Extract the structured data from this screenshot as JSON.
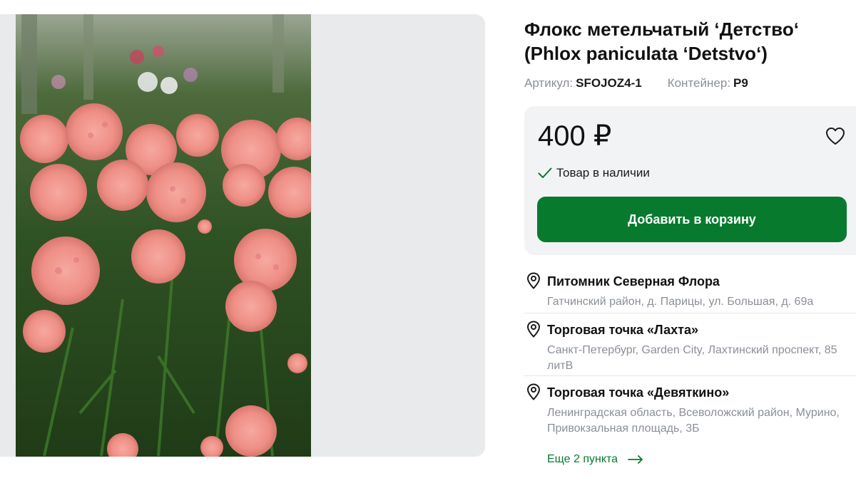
{
  "product": {
    "title": "Флокс метельчатый ʻДетствоʻ (Phlox paniculata ʻDetstvoʻ)",
    "sku_label": "Артикул:",
    "sku_value": "SFOJOZ4-1",
    "container_label": "Контейнер:",
    "container_value": "P9",
    "image_alt": "Флокс метельчатый Детство"
  },
  "buy": {
    "price": "400 ₽",
    "stock_text": "Товар в наличии",
    "add_to_cart": "Добавить в корзину",
    "favorite_icon": "heart-outline-icon",
    "stock_icon": "checkmark-icon"
  },
  "stores": [
    {
      "name": "Питомник Северная Флора",
      "address": "Гатчинский район, д. Парицы, ул. Большая, д. 69а"
    },
    {
      "name": "Торговая точка «Лахта»",
      "address": "Санкт-Петербург, Garden City, Лахтинский проспект, 85 литВ"
    },
    {
      "name": "Торговая точка «Девяткино»",
      "address": "Ленинградская область, Всеволожский район, Мурино, Привокзальная площадь, 3Б"
    }
  ],
  "more_link": "Еще 2 пункта",
  "colors": {
    "accent_green": "#087a2e",
    "card_bg": "#f2f3f5",
    "muted_text": "#8a8f98"
  }
}
